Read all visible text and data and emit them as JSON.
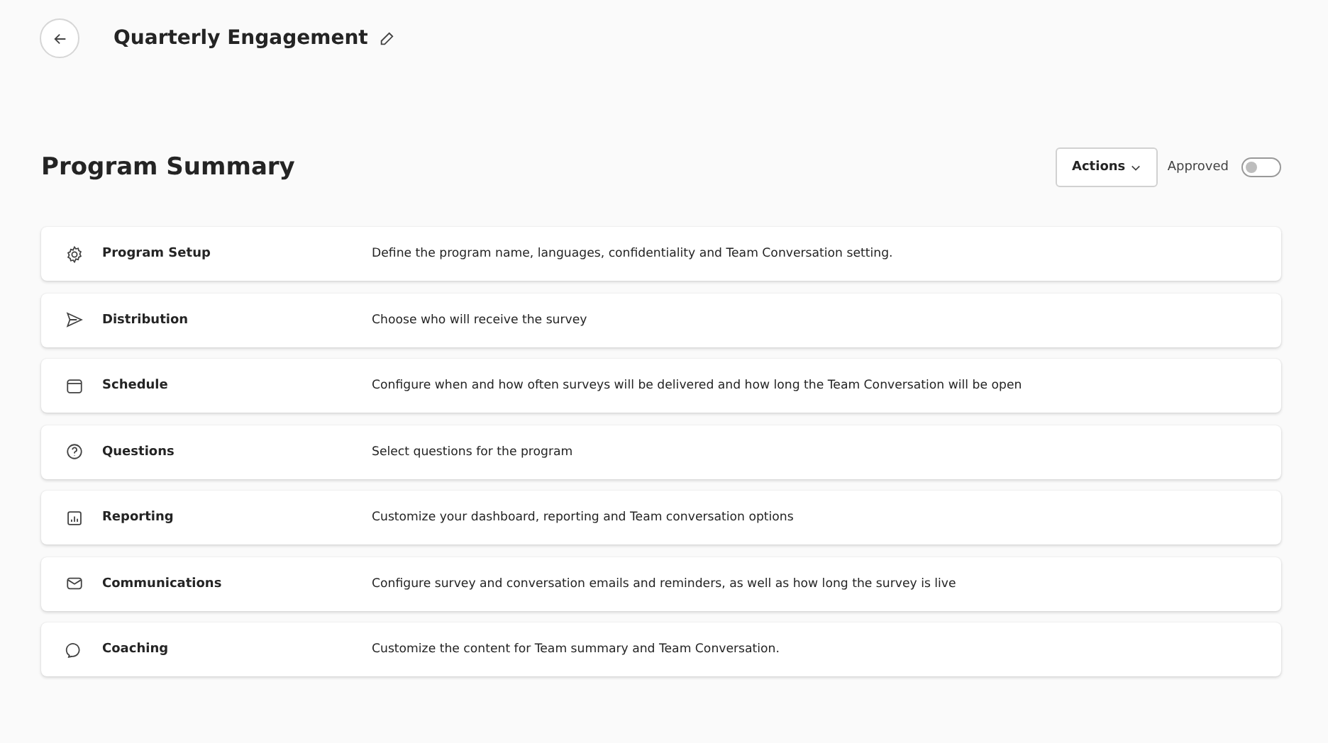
{
  "header": {
    "title": "Quarterly Engagement"
  },
  "summary": {
    "title": "Program Summary",
    "actions_button": "Actions",
    "approved": {
      "label": "Approved",
      "on": false
    }
  },
  "sections": [
    {
      "kind": "gear",
      "name": "Program Setup",
      "description": "Define the program name, languages, confidentiality and Team Conversation setting."
    },
    {
      "kind": "send",
      "name": "Distribution",
      "description": "Choose who will receive the survey"
    },
    {
      "kind": "calendar",
      "name": "Schedule",
      "description": "Configure when and how often surveys will be delivered and how long the Team Conversation will be open"
    },
    {
      "kind": "question",
      "name": "Questions",
      "description": "Select questions for the program"
    },
    {
      "kind": "chart",
      "name": "Reporting",
      "description": "Customize your dashboard, reporting and Team conversation options"
    },
    {
      "kind": "mail",
      "name": "Communications",
      "description": "Configure survey and conversation emails and reminders, as well as how long the survey is live"
    },
    {
      "kind": "chat",
      "name": "Coaching",
      "description": "Customize the content for Team summary and Team Conversation."
    }
  ]
}
